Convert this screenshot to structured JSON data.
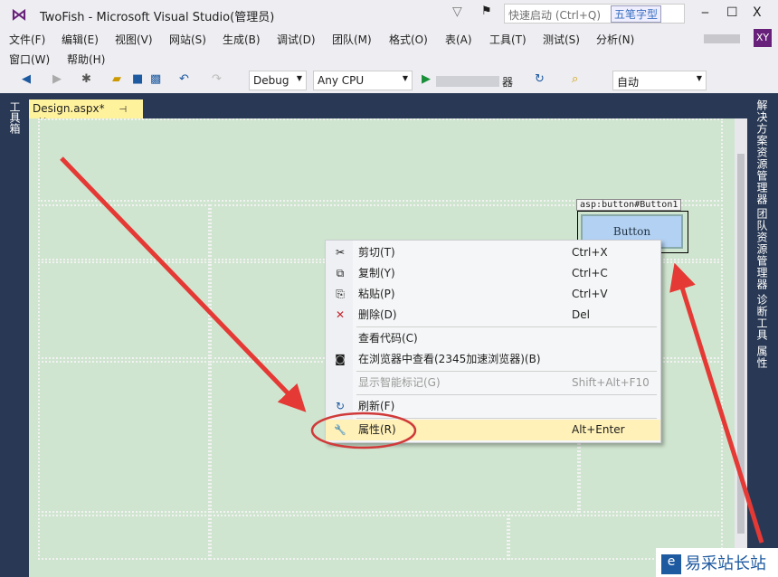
{
  "window": {
    "title": "TwoFish - Microsoft Visual Studio(管理员)",
    "quick_launch_placeholder": "快速启动 (Ctrl+Q)",
    "ime": "五笔字型",
    "minimize": "‒",
    "maximize": "☐",
    "close": "X",
    "user_initials": "XY"
  },
  "menu": [
    "文件(F)",
    "编辑(E)",
    "视图(V)",
    "网站(S)",
    "生成(B)",
    "调试(D)",
    "团队(M)",
    "格式(O)",
    "表(A)",
    "工具(T)",
    "测试(S)",
    "分析(N)",
    "窗口(W)",
    "帮助(H)"
  ],
  "toolbar": {
    "config": "Debug",
    "platform": "Any CPU",
    "run_target": "器",
    "zoom_mode": "自动"
  },
  "left_panel": "工具箱",
  "doc_tab": {
    "label": "Design.aspx*",
    "pin": "⊣",
    "close": "✕"
  },
  "design": {
    "control_tag": "asp:button#Button1",
    "button_text": "Button"
  },
  "context_menu": [
    {
      "icon": "scissors-icon",
      "glyph": "✂",
      "label": "剪切(T)",
      "shortcut": "Ctrl+X"
    },
    {
      "icon": "copy-icon",
      "glyph": "⧉",
      "label": "复制(Y)",
      "shortcut": "Ctrl+C"
    },
    {
      "icon": "paste-icon",
      "glyph": "⎘",
      "label": "粘贴(P)",
      "shortcut": "Ctrl+V"
    },
    {
      "icon": "delete-icon",
      "glyph": "✕",
      "label": "删除(D)",
      "shortcut": "Del"
    },
    {
      "icon": "",
      "glyph": "",
      "label": "查看代码(C)",
      "shortcut": ""
    },
    {
      "icon": "browser-icon",
      "glyph": "◙",
      "label": "在浏览器中查看(2345加速浏览器)(B)",
      "shortcut": ""
    },
    {
      "icon": "",
      "glyph": "",
      "label": "显示智能标记(G)",
      "shortcut": "Shift+Alt+F10"
    },
    {
      "icon": "refresh-icon",
      "glyph": "↻",
      "label": "刷新(F)",
      "shortcut": ""
    },
    {
      "icon": "wrench-icon",
      "glyph": "🔧",
      "label": "属性(R)",
      "shortcut": "Alt+Enter"
    }
  ],
  "right_tabs": [
    "解决方案资源管理器",
    "团队资源管理器",
    "诊断工具",
    "属性"
  ],
  "watermark": "易采站长站"
}
